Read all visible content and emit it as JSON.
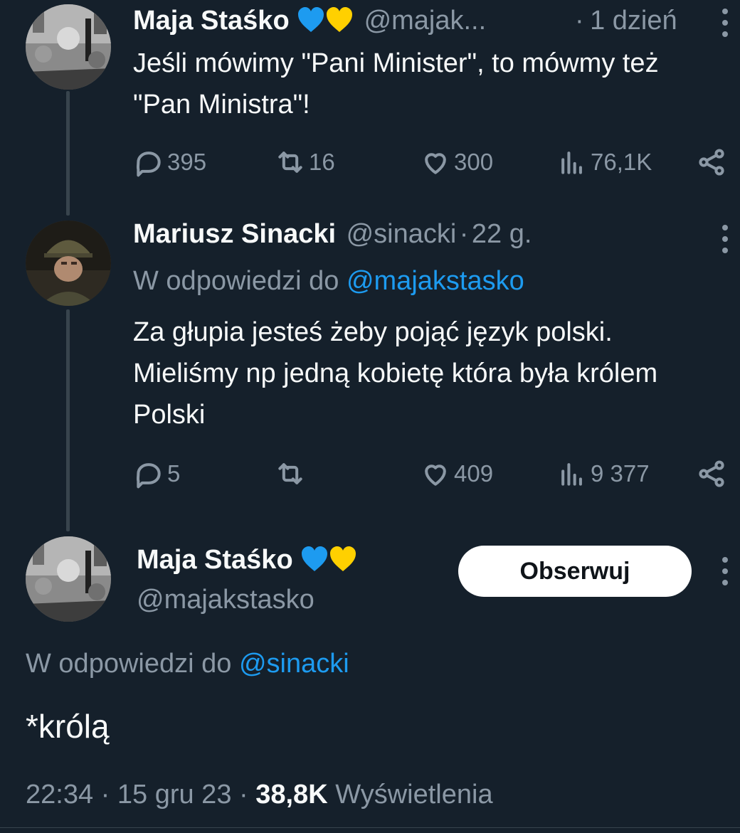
{
  "tweets": [
    {
      "author": "Maja Staśko",
      "handle": "@majak...",
      "separator": "·",
      "time": "1 dzień",
      "text": "Jeśli mówimy \"Pani Minister\", to mówmy też \"Pan Ministra\"!",
      "actions": {
        "replies": "395",
        "retweets": "16",
        "likes": "300",
        "views": "76,1K"
      }
    },
    {
      "author": "Mariusz Sinacki",
      "handle": "@sinacki",
      "separator": "·",
      "time": "22 g.",
      "reply_prefix": "W odpowiedzi do",
      "reply_mention": "@majakstasko",
      "text": "Za głupia jesteś żeby pojąć język polski. Mieliśmy np jedną kobietę która była królem Polski",
      "actions": {
        "replies": "5",
        "retweets": "",
        "likes": "409",
        "views": "9 377"
      }
    }
  ],
  "main_tweet": {
    "author": "Maja Staśko",
    "handle": "@majakstasko",
    "follow_label": "Obserwuj",
    "reply_prefix": "W odpowiedzi do",
    "reply_mention": "@sinacki",
    "text": "*królą",
    "time": "22:34",
    "sep1": "·",
    "date": "15 gru 23",
    "sep2": "·",
    "views_count": "38,8K",
    "views_label": "Wyświetlenia"
  },
  "colors": {
    "background": "#15202b",
    "text": "#f7f9f9",
    "muted": "#8b98a5",
    "accent": "#1d9bf0",
    "heart_blue": "#1d9bf0",
    "heart_yellow": "#ffd000"
  },
  "icons": [
    "reply-icon",
    "retweet-icon",
    "like-icon",
    "views-icon",
    "share-icon",
    "more-icon",
    "blue-heart-icon",
    "yellow-heart-icon"
  ]
}
